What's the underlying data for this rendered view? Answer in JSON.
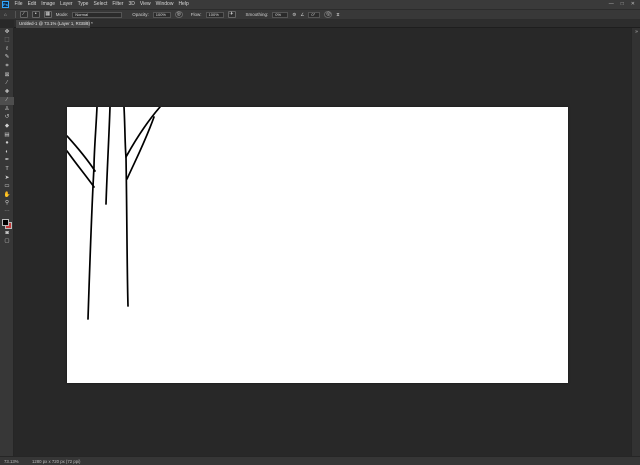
{
  "menubar": {
    "logo": "Ps",
    "items": [
      "File",
      "Edit",
      "Image",
      "Layer",
      "Type",
      "Select",
      "Filter",
      "3D",
      "View",
      "Window",
      "Help"
    ],
    "window_controls": [
      "—",
      "□",
      "✕"
    ]
  },
  "options": {
    "mode_label": "Mode:",
    "mode_value": "Normal",
    "opacity_label": "Opacity:",
    "opacity_value": "100%",
    "flow_label": "Flow:",
    "flow_value": "100%",
    "smoothing_label": "Smoothing:",
    "smoothing_value": "0%",
    "angle_value": "0°"
  },
  "tab": {
    "title": "Untitled-1 @ 73.1% (Layer 1, RGB/8) *",
    "close": "×"
  },
  "toolbar": {
    "tools": [
      {
        "name": "move-tool",
        "glyph": "✥"
      },
      {
        "name": "marquee-tool",
        "glyph": "⬚"
      },
      {
        "name": "lasso-tool",
        "glyph": "ℓ"
      },
      {
        "name": "quick-select-tool",
        "glyph": "✎"
      },
      {
        "name": "crop-tool",
        "glyph": "⌗"
      },
      {
        "name": "frame-tool",
        "glyph": "⊠"
      },
      {
        "name": "eyedropper-tool",
        "glyph": "⁄"
      },
      {
        "name": "healing-tool",
        "glyph": "✚"
      },
      {
        "name": "brush-tool",
        "glyph": "∕"
      },
      {
        "name": "clone-stamp-tool",
        "glyph": "♙"
      },
      {
        "name": "history-brush-tool",
        "glyph": "↺"
      },
      {
        "name": "eraser-tool",
        "glyph": "◆"
      },
      {
        "name": "gradient-tool",
        "glyph": "▤"
      },
      {
        "name": "blur-tool",
        "glyph": "●"
      },
      {
        "name": "dodge-tool",
        "glyph": "◐"
      },
      {
        "name": "pen-tool",
        "glyph": "✒"
      },
      {
        "name": "type-tool",
        "glyph": "T"
      },
      {
        "name": "path-select-tool",
        "glyph": "➤"
      },
      {
        "name": "shape-tool",
        "glyph": "▭"
      },
      {
        "name": "hand-tool",
        "glyph": "✋"
      },
      {
        "name": "zoom-tool",
        "glyph": "⚲"
      },
      {
        "name": "more-tools",
        "glyph": "⋯"
      }
    ],
    "active_tool": "brush-tool",
    "foreground_color": "#000000",
    "background_color": "#c23a3a",
    "mode_tools": [
      {
        "name": "quick-mask-tool",
        "glyph": "◙"
      },
      {
        "name": "screen-mode-tool",
        "glyph": "▢"
      }
    ]
  },
  "statusbar": {
    "zoom": "73.13%",
    "doc_info": "1280 px x 720 px (72 ppi)"
  },
  "colors": {
    "workspace": "#282828",
    "canvas": "#ffffff",
    "stroke": "#000000"
  }
}
